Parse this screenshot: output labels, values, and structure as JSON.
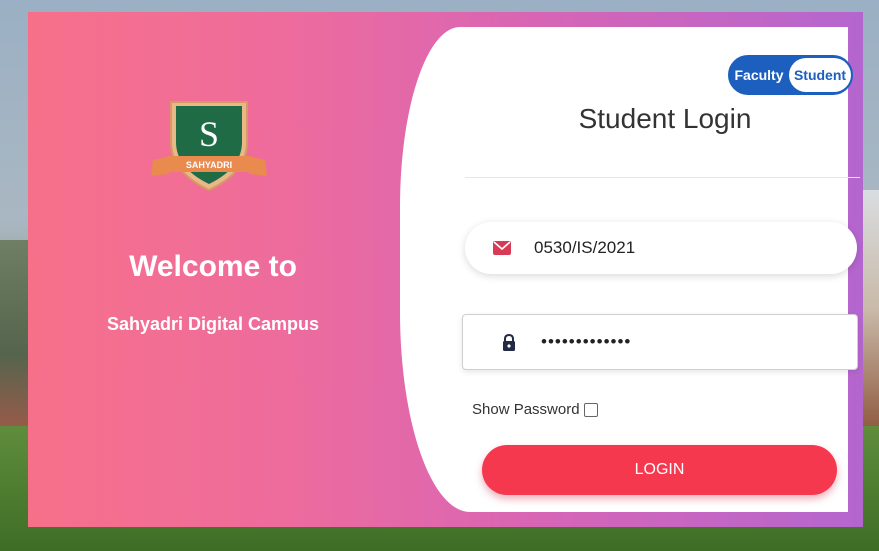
{
  "branding": {
    "logo_letter": "S",
    "logo_ribbon_text": "SAHYADRI",
    "welcome_text": "Welcome to",
    "campus_name": "Sahyadri Digital Campus"
  },
  "role_toggle": {
    "faculty_label": "Faculty",
    "student_label": "Student",
    "selected": "Student"
  },
  "login": {
    "title": "Student Login",
    "username_value": "0530/IS/2021",
    "password_value": "•••••••••••••",
    "show_password_label": "Show Password",
    "show_password_checked": false,
    "submit_label": "LOGIN"
  },
  "icons": {
    "username": "envelope-icon",
    "password": "lock-icon"
  },
  "colors": {
    "accent": "#f6384f",
    "toggle_blue": "#1c5fbf",
    "gradient_start": "#f7708a",
    "gradient_end": "#b466cf",
    "shield_green": "#1f6b45",
    "ribbon_orange": "#e98a4e"
  }
}
